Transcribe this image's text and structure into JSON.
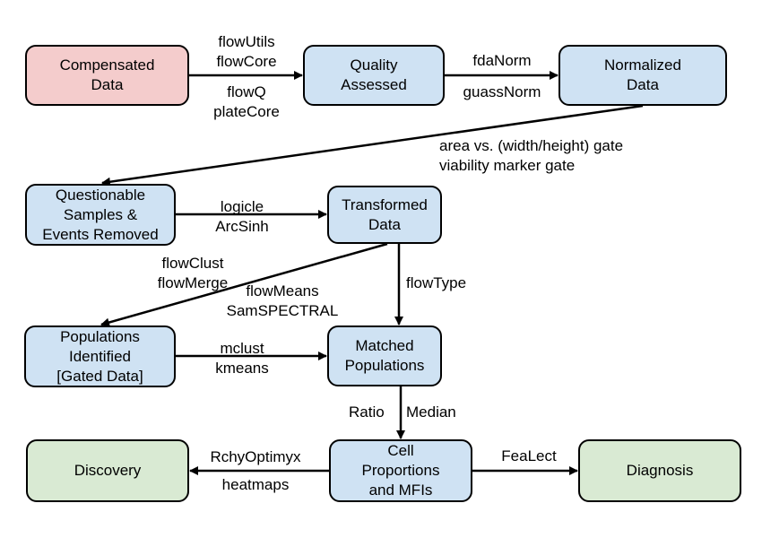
{
  "colors": {
    "source": "#f4cccc",
    "process": "#cfe2f3",
    "outcome": "#d9ead3",
    "stroke": "#000000"
  },
  "nodes": {
    "compensated": "Compensated\nData",
    "quality": "Quality\nAssessed",
    "normalized": "Normalized\nData",
    "questionable": "Questionable\nSamples &\nEvents Removed",
    "transformed": "Transformed\nData",
    "populations": "Populations\nIdentified\n[Gated Data]",
    "matched": "Matched\nPopulations",
    "cell": "Cell\nProportions\nand MFIs",
    "discovery": "Discovery",
    "diagnosis": "Diagnosis"
  },
  "edges": {
    "compensated_quality_above": "flowUtils\nflowCore",
    "compensated_quality_below": "flowQ\nplateCore",
    "quality_normalized_above": "fdaNorm",
    "quality_normalized_below": "guassNorm",
    "normalized_questionable": "area vs. (width/height) gate\nviability marker gate",
    "questionable_transformed": "logicle\nArcSinh",
    "transformed_populations": "flowClust\nflowMerge",
    "transformed_populations_2": "flowMeans\nSamSPECTRAL",
    "transformed_matched": "flowType",
    "populations_matched": "mclust\nkmeans",
    "matched_cell_left": "Ratio",
    "matched_cell_right": "Median",
    "cell_discovery_above": "RchyOptimyx",
    "cell_discovery_below": "heatmaps",
    "cell_diagnosis": "FeaLect"
  }
}
